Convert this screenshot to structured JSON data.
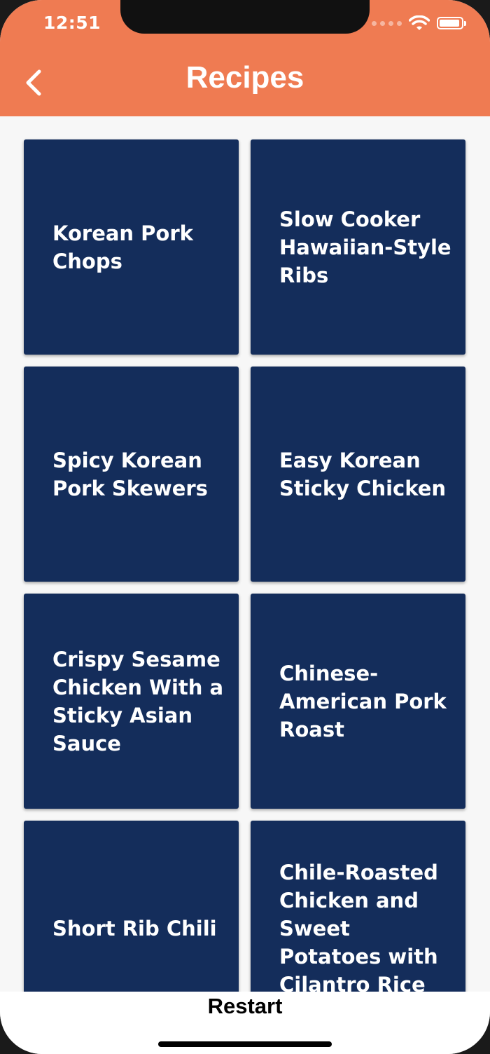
{
  "status_bar": {
    "time": "12:51"
  },
  "header": {
    "title": "Recipes",
    "back_icon": "chevron-left-icon"
  },
  "recipes": [
    {
      "title": "Korean Pork Chops"
    },
    {
      "title": "Slow Cooker Hawaiian-Style Ribs"
    },
    {
      "title": "Spicy Korean Pork Skewers"
    },
    {
      "title": "Easy Korean Sticky Chicken"
    },
    {
      "title": "Crispy Sesame Chicken With a Sticky Asian Sauce"
    },
    {
      "title": "Chinese-American Pork Roast"
    },
    {
      "title": "Short Rib Chili"
    },
    {
      "title": "Chile-Roasted Chicken and Sweet Potatoes with Cilantro Rice"
    }
  ],
  "footer": {
    "restart_label": "Restart"
  },
  "colors": {
    "header": "#ef7b52",
    "card": "#142d5b",
    "background": "#f7f7f7"
  }
}
